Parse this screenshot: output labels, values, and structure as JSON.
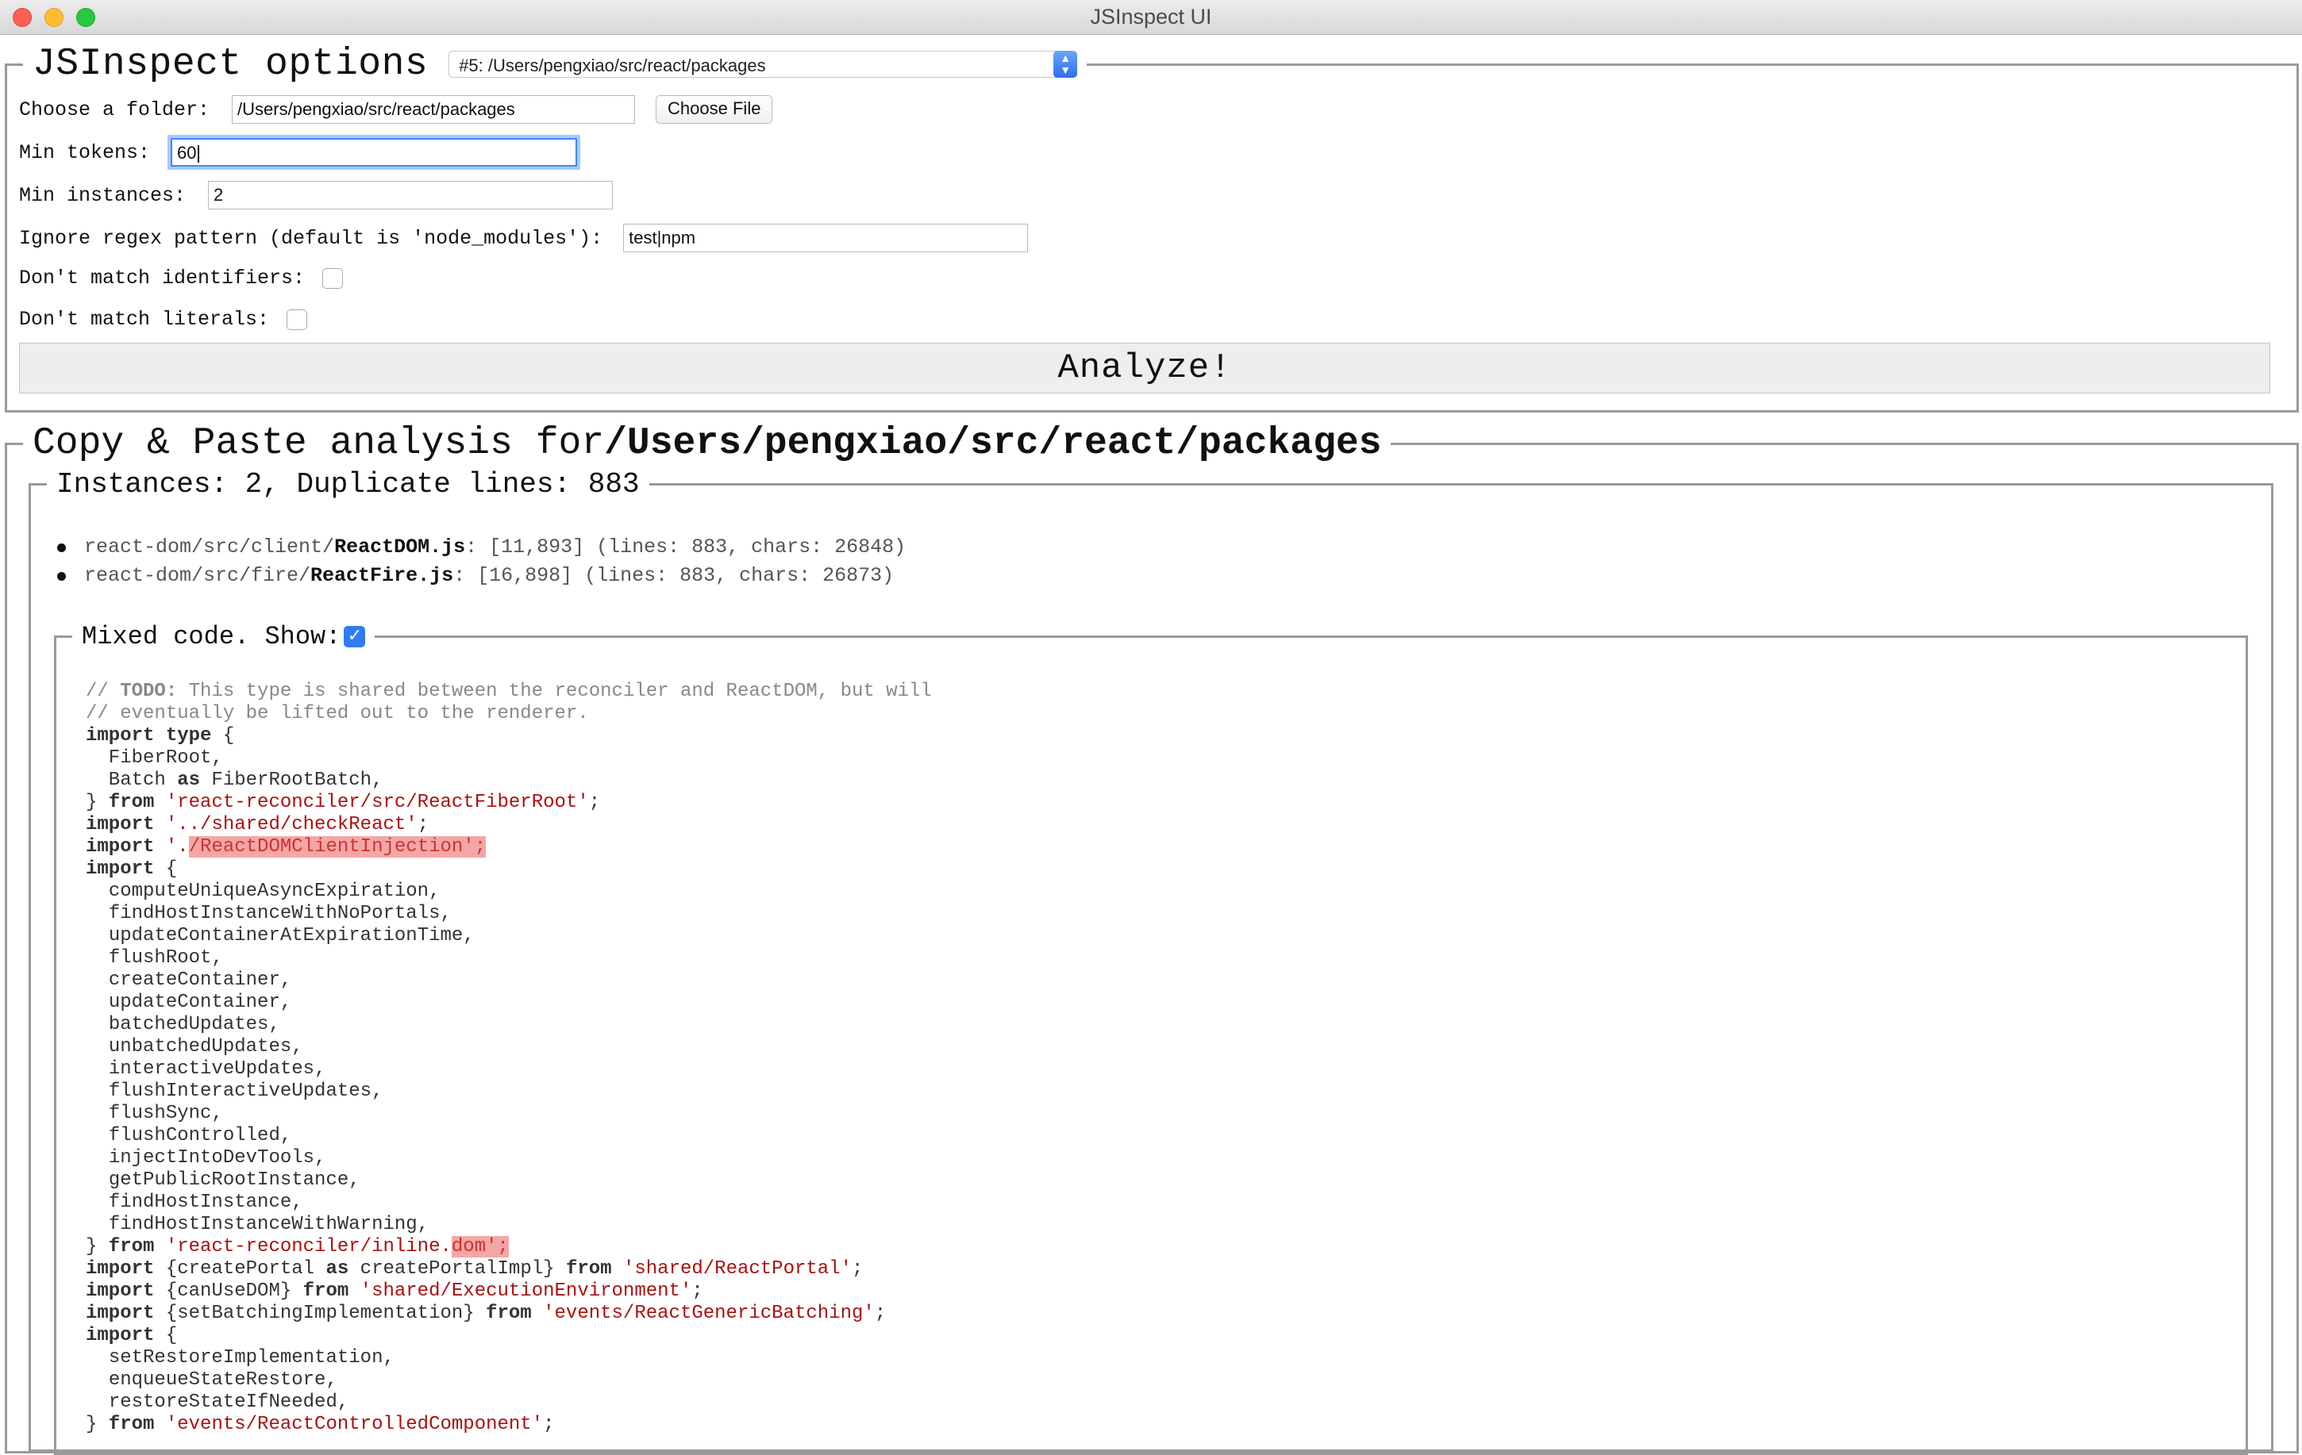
{
  "window": {
    "title": "JSInspect UI"
  },
  "options": {
    "title": "JSInspect options",
    "preset": "#5: /Users/pengxiao/src/react/packages",
    "folder_label": "Choose a folder:",
    "folder_value": "/Users/pengxiao/src/react/packages",
    "choose_file_label": "Choose File",
    "min_tokens_label": "Min tokens:",
    "min_tokens_value": "60",
    "min_instances_label": "Min instances:",
    "min_instances_value": "2",
    "ignore_label": "Ignore regex pattern (default is 'node_modules'):",
    "ignore_value": "test|npm",
    "no_identifiers_label": "Don't match identifiers:",
    "no_identifiers_checked": false,
    "no_literals_label": "Don't match literals:",
    "no_literals_checked": false,
    "analyze_label": "Analyze!"
  },
  "analysis": {
    "title_prefix": "Copy & Paste analysis for",
    "title_path": "/Users/pengxiao/src/react/packages",
    "instances_legend": "Instances: 2, Duplicate lines: 883",
    "files": [
      {
        "dir": "react-dom/src/client/",
        "name": "ReactDOM.js",
        "info": ": [11,893] (lines: 883, chars: 26848)"
      },
      {
        "dir": "react-dom/src/fire/",
        "name": "ReactFire.js",
        "info": ": [16,898] (lines: 883, chars: 26873)"
      }
    ],
    "mixed_label": "Mixed code. Show:",
    "mixed_checked": true,
    "code": {
      "l1": "This type is shared between the reconciler and ReactDOM, but will",
      "l1_todo": "TODO:",
      "l2": "// eventually be lifted out to the renderer.",
      "l3_kw": "import type",
      "l3": " {",
      "l4": "  FiberRoot,",
      "l5a": "  Batch ",
      "l5_kw": "as",
      "l5b": " FiberRootBatch,",
      "l6a": "} ",
      "l6_kw": "from",
      "l6_str": "'react-reconciler/src/ReactFiberRoot'",
      "l7_str": "'../shared/checkReact'",
      "l8_str": "'.",
      "l8_hl": "/ReactDOMClientInjection';",
      "l9": " {",
      "ids": [
        "computeUniqueAsyncExpiration",
        "findHostInstanceWithNoPortals",
        "updateContainerAtExpirationTime",
        "flushRoot",
        "createContainer",
        "updateContainer",
        "batchedUpdates",
        "unbatchedUpdates",
        "interactiveUpdates",
        "flushInteractiveUpdates",
        "flushSync",
        "flushControlled",
        "injectIntoDevTools",
        "getPublicRootInstance",
        "findHostInstance",
        "findHostInstanceWithWarning"
      ],
      "l26_str": "'react-reconciler/inline.",
      "l26_hl": "dom';",
      "l27a": "{createPortal ",
      "l27b": " createPortalImpl} ",
      "l27_str": "'shared/ReactPortal'",
      "l28a": "{canUseDOM} ",
      "l28_str": "'shared/ExecutionEnvironment'",
      "l29a": "{setBatchingImplementation} ",
      "l29_str": "'events/ReactGenericBatching'",
      "ids2": [
        "setRestoreImplementation",
        "enqueueStateRestore",
        "restoreStateIfNeeded"
      ],
      "l34_str": "'events/ReactControlledComponent'",
      "kw_import": "import",
      "kw_from": "from",
      "kw_as": "as",
      "semi": ";",
      "comment_prefix": "// ",
      "brace_open": " {",
      "brace_close": "} "
    }
  },
  "colors": {
    "accent": "#2f7cf6",
    "string": "#aa1111",
    "highlight": "#f4a6a6",
    "border": "#9a9a9a"
  }
}
